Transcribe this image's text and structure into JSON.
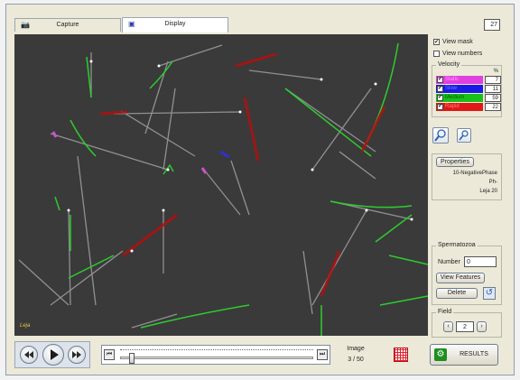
{
  "tabs": [
    {
      "label": "Capture",
      "icon": "camera-icon"
    },
    {
      "label": "Display",
      "icon": "monitor-icon"
    }
  ],
  "counter": "27",
  "options": {
    "view_mask": "View mask",
    "view_numbers": "View numbers"
  },
  "velocity": {
    "title": "Velocity",
    "percent_header": "%",
    "rows": [
      {
        "label": "Static",
        "value": "7",
        "color": "#e040e0"
      },
      {
        "label": "Slow",
        "value": "11",
        "color": "#1a1ae6"
      },
      {
        "label": "Medium",
        "value": "59",
        "color": "#18c018"
      },
      {
        "label": "Rapid",
        "value": "22",
        "color": "#e01818"
      }
    ]
  },
  "properties": {
    "button": "Properties",
    "lines": [
      "10-NegativePhase",
      "Ph-",
      "Leja 20"
    ]
  },
  "spermatozoa": {
    "title": "Spermatozoa",
    "number_label": "Number",
    "number_value": "0",
    "view_features": "View Features",
    "delete": "Delete"
  },
  "field": {
    "title": "Field",
    "value": "2"
  },
  "image": {
    "label": "Image",
    "current": "3",
    "separator": "/",
    "total": "50"
  },
  "results_label": "RESULTS",
  "overlay_logo": "Leja",
  "colors": {
    "medium": "#2ecc2e",
    "rapid": "#b01010",
    "static": "#d050d0",
    "slow": "#3030d0",
    "track": "#9a9a9a"
  }
}
